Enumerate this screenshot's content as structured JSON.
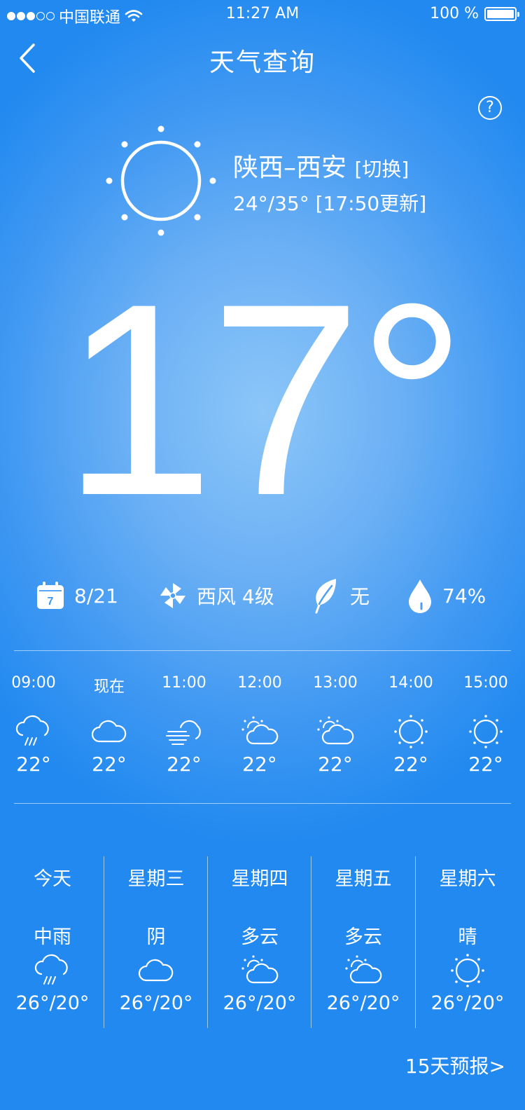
{
  "status_bar": {
    "carrier": "中国联通",
    "time": "11:27 AM",
    "battery": "100 %",
    "battery_level": 1.0,
    "signal_bars_filled": 3,
    "signal_bars_total": 5
  },
  "nav": {
    "title": "天气查询",
    "back_icon": "chevron-left-icon",
    "help_label": "?"
  },
  "location": {
    "name": "陕西–西安",
    "switch_label": "[切换]",
    "temp_range": "24°/35°",
    "updated": "[17:50更新]",
    "icon": "sun-icon"
  },
  "current_temp": "17°",
  "info": {
    "date": "8/21",
    "calendar_day": "7",
    "wind": "西风 4级",
    "pollen": "无",
    "humidity": "74%"
  },
  "hourly": [
    {
      "time": "09:00",
      "icon": "rain-icon",
      "temp": "22°"
    },
    {
      "time": "现在",
      "icon": "cloud-icon",
      "temp": "22°"
    },
    {
      "time": "11:00",
      "icon": "fog-cloud-icon",
      "temp": "22°"
    },
    {
      "time": "12:00",
      "icon": "partly-cloudy-icon",
      "temp": "22°"
    },
    {
      "time": "13:00",
      "icon": "partly-cloudy-icon",
      "temp": "22°"
    },
    {
      "time": "14:00",
      "icon": "sun-icon",
      "temp": "22°"
    },
    {
      "time": "15:00",
      "icon": "sun-icon",
      "temp": "22°"
    }
  ],
  "daily": [
    {
      "day": "今天",
      "condition": "中雨",
      "icon": "rain-icon",
      "range": "26°/20°"
    },
    {
      "day": "星期三",
      "condition": "阴",
      "icon": "cloud-icon",
      "range": "26°/20°"
    },
    {
      "day": "星期四",
      "condition": "多云",
      "icon": "partly-cloudy-icon",
      "range": "26°/20°"
    },
    {
      "day": "星期五",
      "condition": "多云",
      "icon": "partly-cloudy-icon",
      "range": "26°/20°"
    },
    {
      "day": "星期六",
      "condition": "晴",
      "icon": "sun-icon",
      "range": "26°/20°"
    }
  ],
  "more_link": "15天预报>"
}
